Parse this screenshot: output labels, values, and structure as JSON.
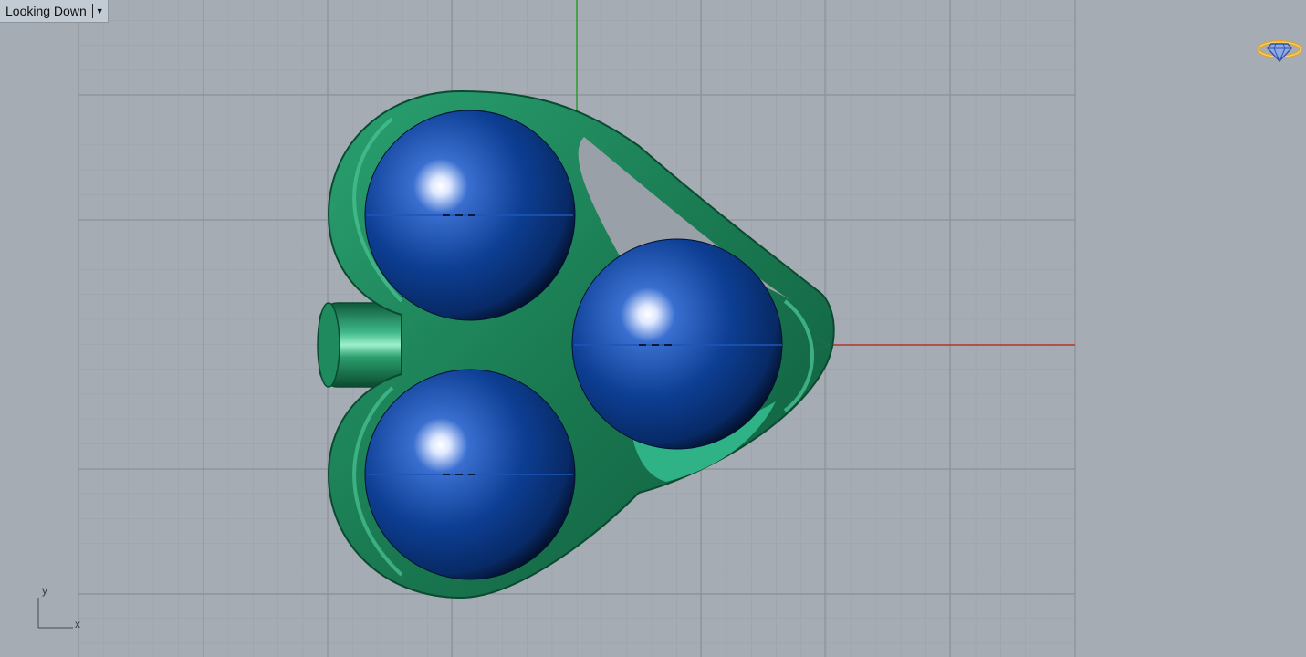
{
  "viewport": {
    "label": "Looking Down",
    "menu_icon": "caret-down-icon",
    "axis_labels": {
      "x": "x",
      "y": "y"
    },
    "logo_icon": "ring-diamond-icon"
  },
  "colors": {
    "background": "#a6acb3",
    "grid_minor": "#9aa0a7",
    "grid_major": "#8d9299",
    "x_axis": "#b8342e",
    "y_axis": "#2f9a2f",
    "band_green": "#1f7d55",
    "sphere_blue": "#0b3a8c",
    "logo": "#e0a62c"
  }
}
